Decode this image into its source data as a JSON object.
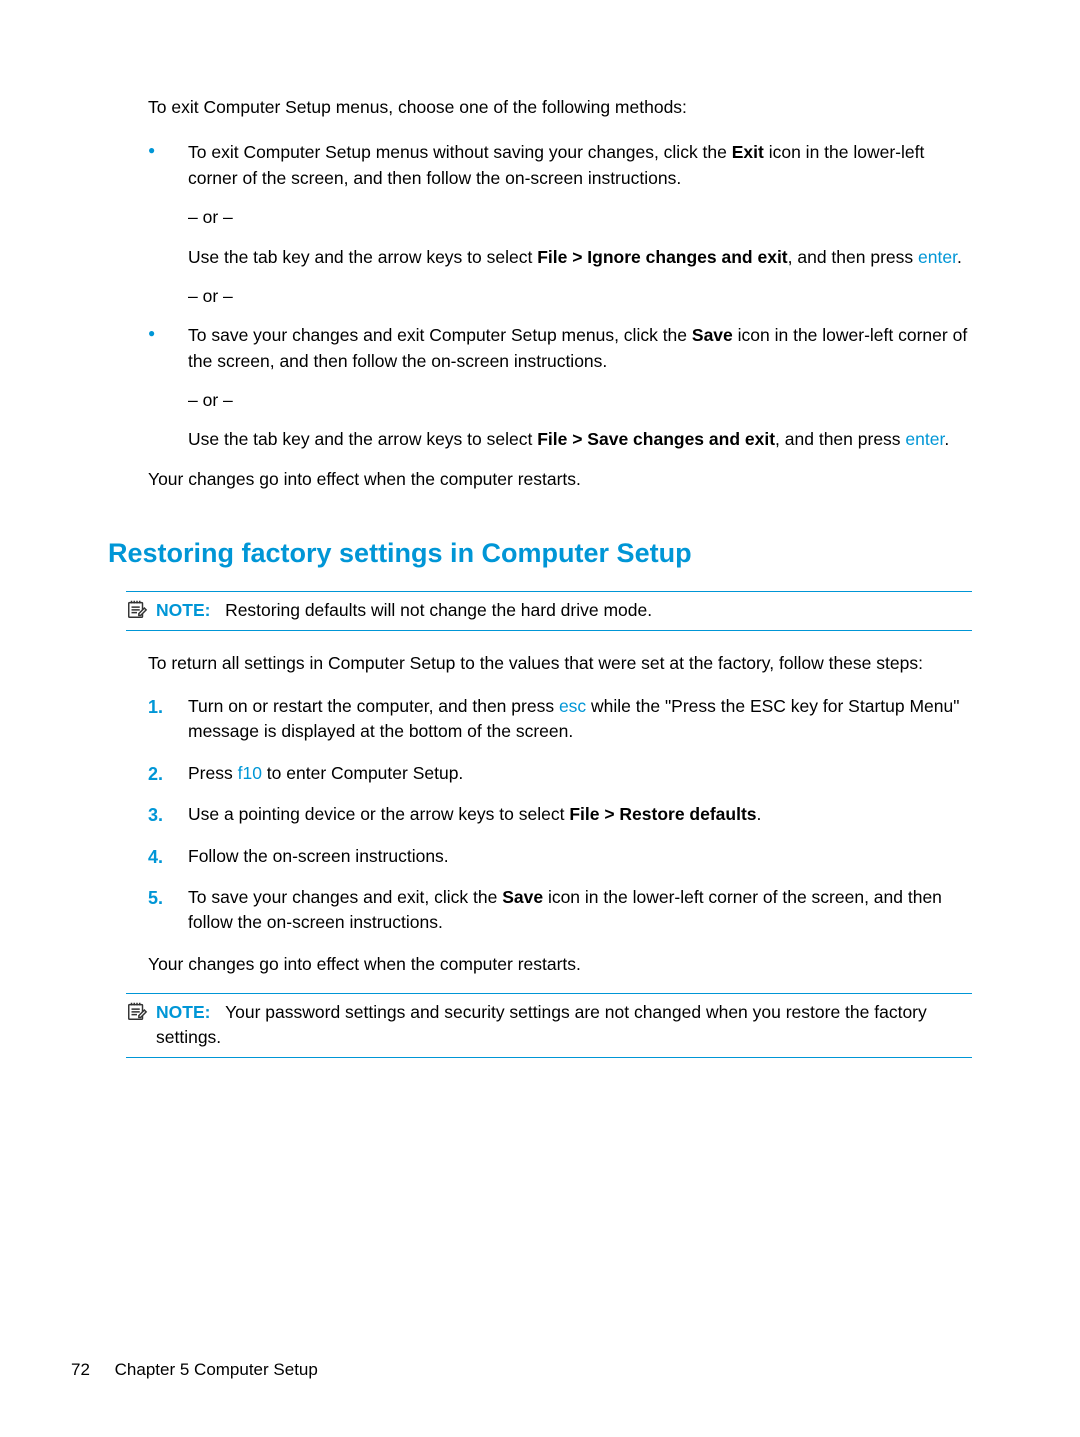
{
  "intro": "To exit Computer Setup menus, choose one of the following methods:",
  "bullets": [
    {
      "line1_pre": "To exit Computer Setup menus without saving your changes, click the ",
      "line1_bold": "Exit",
      "line1_post": " icon in the lower-left corner of the screen, and then follow the on-screen instructions.",
      "or": "– or –",
      "line2_pre": "Use the tab key and the arrow keys to select ",
      "line2_bold": "File > Ignore changes and exit",
      "line2_post1": ", and then press ",
      "line2_key": "enter",
      "line2_post2": ".",
      "or2": "– or –"
    },
    {
      "line1_pre": "To save your changes and exit Computer Setup menus, click the ",
      "line1_bold": "Save",
      "line1_post": " icon in the lower-left corner of the screen, and then follow the on-screen instructions.",
      "or": "– or –",
      "line2_pre": "Use the tab key and the arrow keys to select ",
      "line2_bold": "File > Save changes and exit",
      "line2_post1": ", and then press ",
      "line2_key": "enter",
      "line2_post2": "."
    }
  ],
  "effect": "Your changes go into effect when the computer restarts.",
  "heading": "Restoring factory settings in Computer Setup",
  "note1": {
    "label": "NOTE:",
    "text": "Restoring defaults will not change the hard drive mode."
  },
  "steps_intro": "To return all settings in Computer Setup to the values that were set at the factory, follow these steps:",
  "steps": [
    {
      "pre": "Turn on or restart the computer, and then press ",
      "key": "esc",
      "post": " while the \"Press the ESC key for Startup Menu\" message is displayed at the bottom of the screen."
    },
    {
      "pre": "Press ",
      "key": "f10",
      "post": " to enter Computer Setup."
    },
    {
      "pre": "Use a pointing device or the arrow keys to select ",
      "bold": "File > Restore defaults",
      "post": "."
    },
    {
      "text": "Follow the on-screen instructions."
    },
    {
      "pre": "To save your changes and exit, click the ",
      "bold": "Save",
      "post": " icon in the lower-left corner of the screen, and then follow the on-screen instructions."
    }
  ],
  "effect2": "Your changes go into effect when the computer restarts.",
  "note2": {
    "label": "NOTE:",
    "text": "Your password settings and security settings are not changed when you restore the factory settings."
  },
  "footer": {
    "page_num": "72",
    "chapter": "Chapter 5   Computer Setup"
  }
}
